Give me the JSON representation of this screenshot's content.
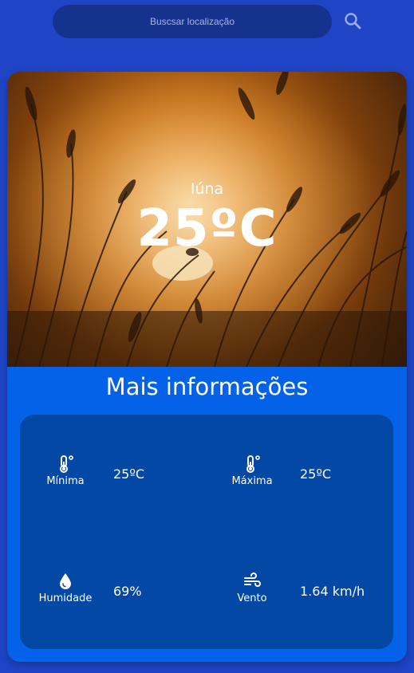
{
  "search": {
    "placeholder": "Buscsar localização",
    "button_icon": "search-icon"
  },
  "hero": {
    "city": "Iúna",
    "temperature": "25ºC",
    "background_icon": "sunset-grass-photo"
  },
  "details": {
    "title": "Mais informações",
    "min": {
      "icon": "thermometer-icon",
      "label": "Mínima",
      "value": "25ºC"
    },
    "max": {
      "icon": "thermometer-icon",
      "label": "Máxima",
      "value": "25ºC"
    },
    "humidity": {
      "icon": "water-drop-icon",
      "label": "Humidade",
      "value": "69%"
    },
    "wind": {
      "icon": "wind-icon",
      "label": "Vento",
      "value": "1.64 km/h"
    }
  },
  "colors": {
    "background": "#1f45c6",
    "search_bar": "#16328f",
    "card": "#0462e8",
    "panel": "#0448a6"
  }
}
